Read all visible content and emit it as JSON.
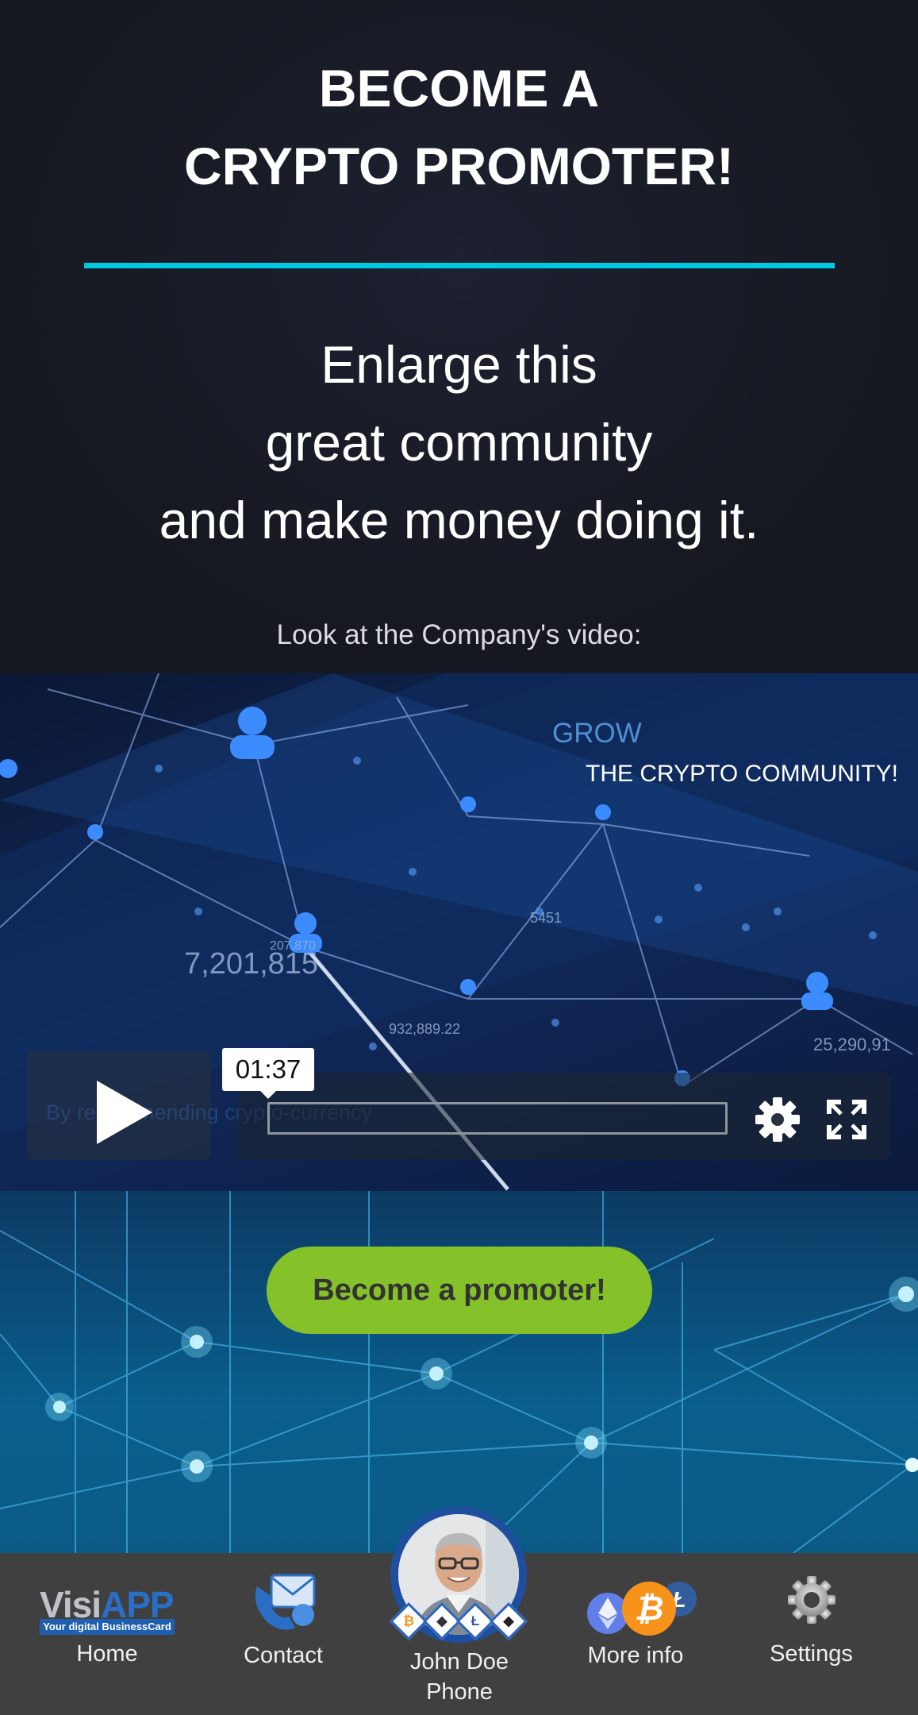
{
  "hero": {
    "title_line1": "BECOME A",
    "title_line2": "CRYPTO PROMOTER!",
    "subtitle_line1": "Enlarge this",
    "subtitle_line2": "great community",
    "subtitle_line3": "and make money doing it.",
    "video_caption": "Look at the Company's video:"
  },
  "video": {
    "overlay_grow": "GROW",
    "overlay_sub": "THE CRYPTO COMMUNITY!",
    "faded_caption": "By recommending crypto-currency",
    "num_a": "7,201,815",
    "num_b": "932,889.22",
    "num_c": "25,290,91",
    "num_d": "5451",
    "num_e": "207,870",
    "time": "01:37",
    "progress": 0.0
  },
  "cta": {
    "label": "Become a promoter!"
  },
  "nav": {
    "logo_visi": "Visi",
    "logo_app": "APP",
    "logo_tagline": "Your digital BusinessCard",
    "home": "Home",
    "contact": "Contact",
    "profile_name": "John Doe",
    "profile_sub": "Phone",
    "more_info": "More info",
    "settings": "Settings",
    "coins": [
      "B",
      "E",
      "L",
      "C"
    ]
  },
  "colors": {
    "accent_line": "#00c8e0",
    "cta_bg": "#85c22a",
    "nav_bg": "#404040",
    "bitcoin": "#f7931a",
    "eth_blue": "#627eea"
  }
}
